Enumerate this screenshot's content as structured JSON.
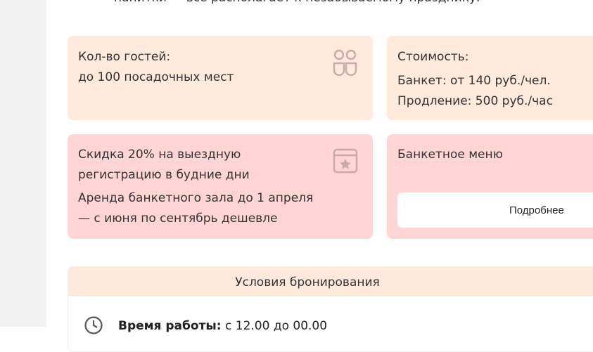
{
  "intro": {
    "text": "напитки — все располагает к незабываемому празднику."
  },
  "cards": {
    "guests": {
      "label": "Кол-во гостей:",
      "value": "до 100 посадочных мест",
      "icon": "people-icon"
    },
    "price": {
      "label": "Стоимость:",
      "banquet": "Банкет: от 140 руб./чел.",
      "extension": "Продление: 500 руб./час"
    },
    "discount": {
      "line1": "Скидка 20% на выездную",
      "line2": "регистрацию в будние дни",
      "line3": "Аренда банкетного зала до 1 апреля",
      "line4": "— с июня по сентябрь дешевле",
      "icon": "calendar-star-icon"
    },
    "menu": {
      "title": "Банкетное меню",
      "button": "Подробнее"
    }
  },
  "booking": {
    "header": "Условия бронирования",
    "hours_label": "Время работы:",
    "hours_value": " с 12.00 до 00.00",
    "icon": "clock-icon"
  },
  "colors": {
    "peach": "#ffeadc",
    "pink": "#ffd5d5",
    "icon": "#c9a9a9"
  }
}
